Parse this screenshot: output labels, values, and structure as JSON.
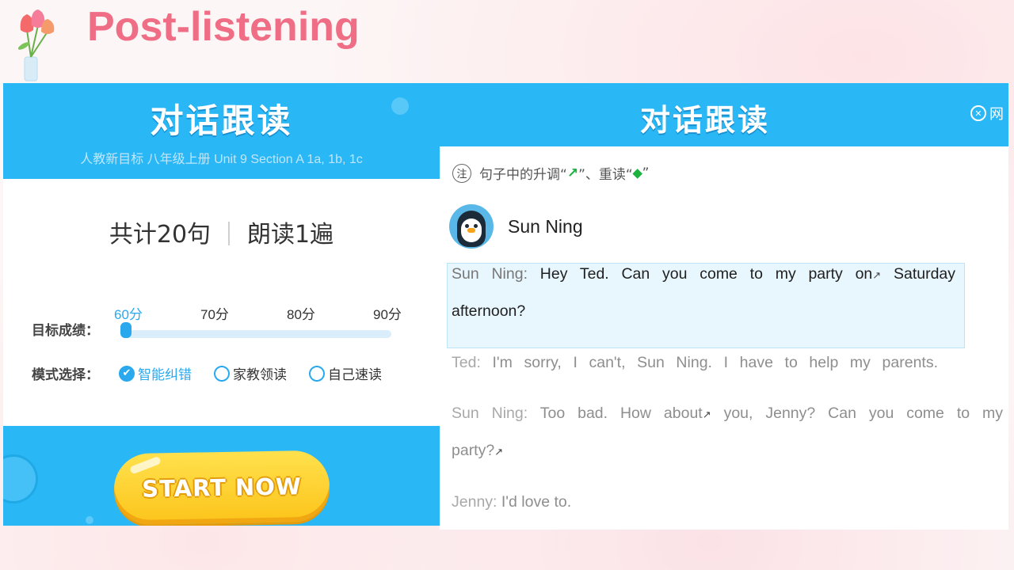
{
  "page": {
    "title": "Post-listening"
  },
  "left": {
    "header_title": "对话跟读",
    "header_subtitle": "人教新目标 八年级上册 Unit 9  Section A 1a, 1b, 1c",
    "count_sentences": "共计20句",
    "count_reads": "朗读1遍",
    "target_label": "目标成绩：",
    "ticks": [
      "60分",
      "70分",
      "80分",
      "90分"
    ],
    "target_value": 60,
    "mode_label": "模式选择：",
    "modes": [
      {
        "label": "智能纠错",
        "checked": true
      },
      {
        "label": "家教领读",
        "checked": false
      },
      {
        "label": "自己速读",
        "checked": false
      }
    ],
    "start_label": "START NOW"
  },
  "right": {
    "header_title": "对话跟读",
    "header_right": "网",
    "note_icon": "注",
    "note_text_1": "句子中的升调“",
    "note_text_2": "”、重读“",
    "note_text_3": "”",
    "speaker_name": "Sun Ning",
    "dialogue": [
      {
        "speaker": "Sun Ning:",
        "line1": "Hey Ted. Can you come to my party on",
        "line1_end": "Saturday",
        "line2": "afternoon?",
        "active": true
      },
      {
        "speaker": "Ted:",
        "text": "I'm sorry, I can't, Sun Ning. I have to help my parents."
      },
      {
        "speaker": "Sun Ning:",
        "line1": "Too bad. How about",
        "line1_mid": "you, Jenny? Can you come to my",
        "line2": "party?"
      },
      {
        "speaker": "Jenny:",
        "text": "I'd love to."
      }
    ]
  },
  "colors": {
    "accent": "#29b7f5",
    "title": "#ef6e85",
    "button": "#fcc41a"
  }
}
